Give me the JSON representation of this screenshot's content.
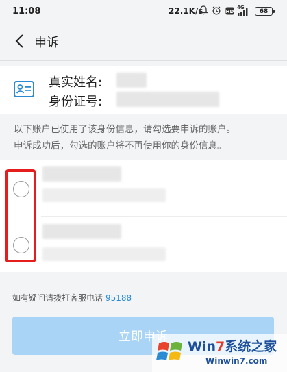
{
  "status_bar": {
    "time": "11:08",
    "net_speed": "22.1K/s",
    "signal_label": "4G",
    "hd_label": "HD",
    "battery": "68"
  },
  "header": {
    "title": "申诉"
  },
  "identity": {
    "name_label": "真实姓名:",
    "id_label": "身份证号:"
  },
  "notice": {
    "line1": "以下账户已使用了该身份信息，请勾选要申诉的账户。",
    "line2": "申诉成功后，勾选的账户将不再使用你的身份信息。"
  },
  "help": {
    "text": "如有疑问请拨打客服电话",
    "phone": "95188"
  },
  "submit": {
    "label": "立即申诉"
  },
  "watermark": {
    "title_a": "Win",
    "title_seven": "7",
    "title_b": "系统之家",
    "url": "Winwin7.com"
  },
  "colors": {
    "accent_blue": "#2a8bd3",
    "button_disabled": "#a9d4f5",
    "highlight_red": "#e51d1d"
  }
}
